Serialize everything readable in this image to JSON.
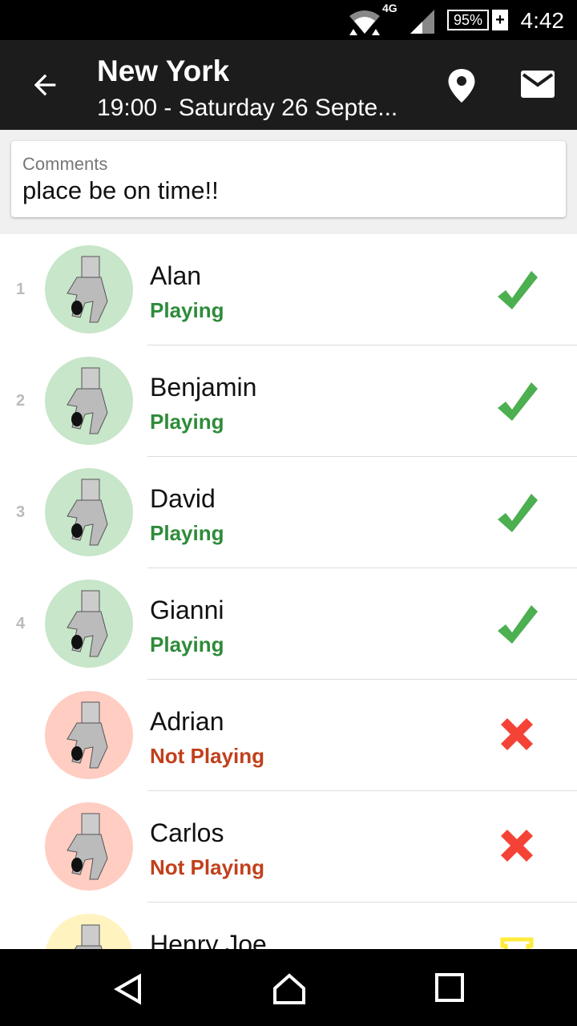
{
  "status_bar": {
    "network": "4G",
    "battery": "95%",
    "charging": "+",
    "time": "4:42"
  },
  "app_bar": {
    "title": "New York",
    "subtitle": "19:00 - Saturday 26 Septe...",
    "icons": [
      "arrow-back-icon",
      "location-pin-icon",
      "mail-icon"
    ]
  },
  "comments": {
    "label": "Comments",
    "value": "place be on time!!"
  },
  "colors": {
    "playing": "#2e8b3a",
    "not_playing": "#c1401c",
    "check": "#4caf50",
    "cross": "#f44336",
    "pending": "#ffeb3b",
    "avatar_green": "#c8e6c9",
    "avatar_red": "#ffcdc2",
    "avatar_yellow": "#fff3c0"
  },
  "players": [
    {
      "number": "1",
      "name": "Alan",
      "status": "Playing",
      "state": "playing"
    },
    {
      "number": "2",
      "name": "Benjamin",
      "status": "Playing",
      "state": "playing"
    },
    {
      "number": "3",
      "name": "David",
      "status": "Playing",
      "state": "playing"
    },
    {
      "number": "4",
      "name": "Gianni",
      "status": "Playing",
      "state": "playing"
    },
    {
      "number": "",
      "name": "Adrian",
      "status": "Not Playing",
      "state": "not_playing"
    },
    {
      "number": "",
      "name": "Carlos",
      "status": "Not Playing",
      "state": "not_playing"
    },
    {
      "number": "",
      "name": "Henry Joe",
      "status": "",
      "state": "pending"
    }
  ]
}
